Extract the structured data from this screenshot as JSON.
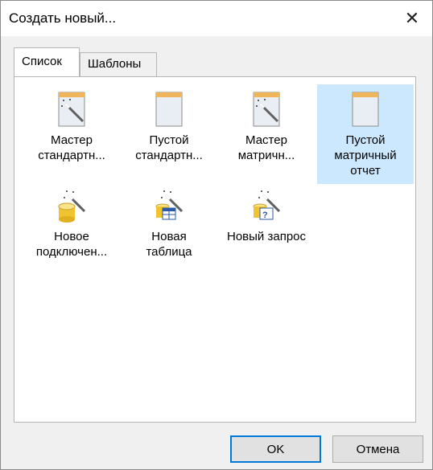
{
  "dialog": {
    "title": "Создать новый...",
    "close_glyph": "✕"
  },
  "tabs": [
    {
      "label": "Список",
      "active": true
    },
    {
      "label": "Шаблоны",
      "active": false
    }
  ],
  "items": [
    {
      "label": "Мастер\nстандартн...",
      "icon": "report-wizard-icon",
      "selected": false
    },
    {
      "label": "Пустой\nстандартн...",
      "icon": "blank-report-icon",
      "selected": false
    },
    {
      "label": "Мастер\nматричн...",
      "icon": "matrix-wizard-icon",
      "selected": false
    },
    {
      "label": "Пустой\nматричный\nотчет",
      "icon": "blank-matrix-report-icon",
      "selected": true
    },
    {
      "label": "Новое\nподключен...",
      "icon": "database-connection-wizard-icon",
      "selected": false
    },
    {
      "label": "Новая\nтаблица",
      "icon": "table-wizard-icon",
      "selected": false
    },
    {
      "label": "Новый запрос",
      "icon": "query-wizard-icon",
      "selected": false
    }
  ],
  "buttons": {
    "ok": "OK",
    "cancel": "Отмена"
  },
  "colors": {
    "selection": "#cce8ff",
    "default_button_border": "#0078d7"
  }
}
